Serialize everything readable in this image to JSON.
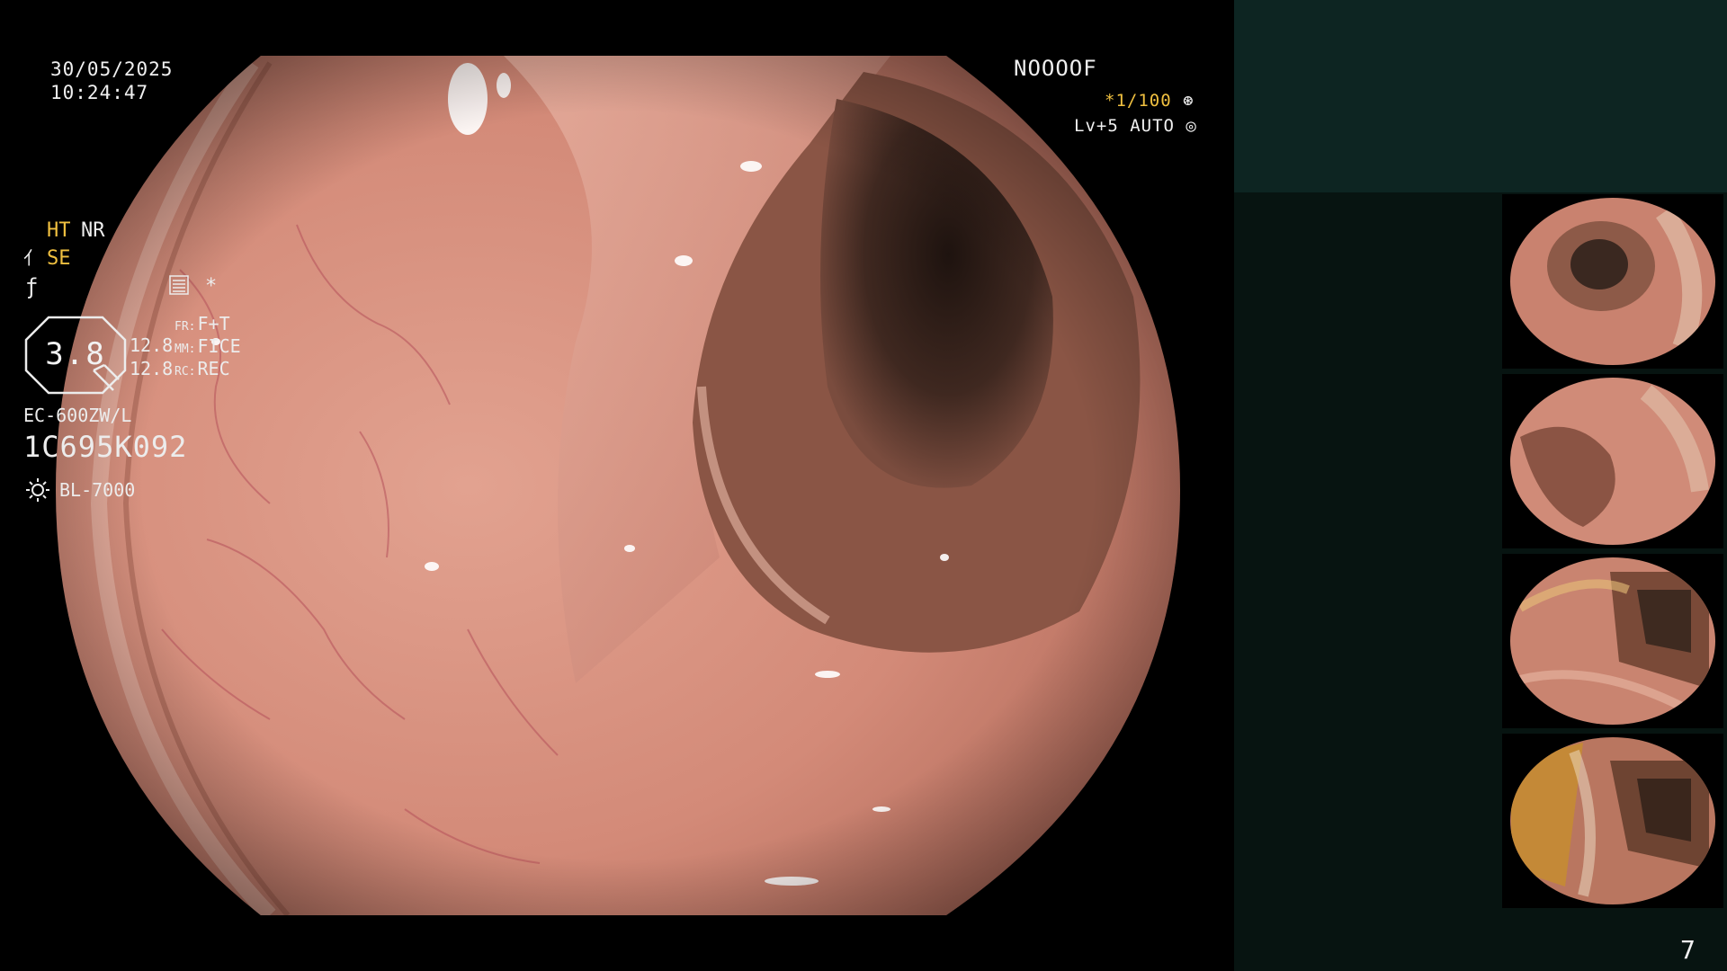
{
  "osd": {
    "date": "30/05/2025",
    "time": "10:24:47",
    "code": "NOOOOF",
    "shutter": "*1/100",
    "level": "Lv+5 AUTO"
  },
  "panel": {
    "ht": "HT",
    "nr": "NR",
    "se": "SE",
    "star": "*",
    "zoom": "3.8",
    "mm_value": "12.8",
    "rc_value": "12.8",
    "fr_key": "FR:",
    "fr_val": "F+T",
    "mm_key": "MM:",
    "mm_val": "FICE",
    "rc_key": "RC:",
    "rc_val": "REC",
    "scope_model": "EC-600ZW/L",
    "scope_serial": "1C695K092",
    "lamp": "BL-7000"
  },
  "thumbnails": [
    {
      "label": "thumbnail 1"
    },
    {
      "label": "thumbnail 2"
    },
    {
      "label": "thumbnail 3"
    },
    {
      "label": "thumbnail 4"
    }
  ],
  "page_number": "7",
  "colors": {
    "panel_top": "#0d2522",
    "panel_body": "#071411",
    "amber": "#f0c040",
    "mucosa": "#d9917f"
  }
}
